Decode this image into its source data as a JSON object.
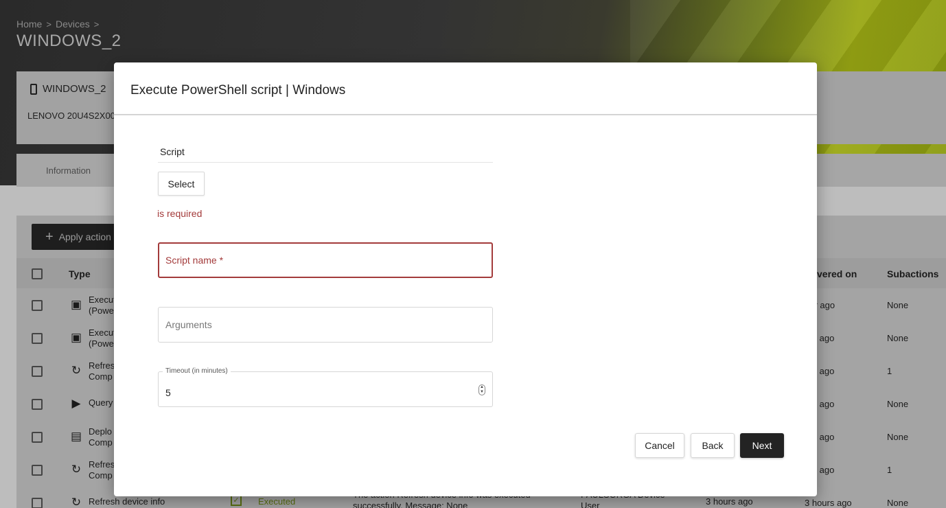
{
  "breadcrumb": {
    "home": "Home",
    "devices": "Devices",
    "separator": ">"
  },
  "page_title": "WINDOWS_2",
  "device_card": {
    "name": "WINDOWS_2",
    "model": "LENOVO 20U4S2X00"
  },
  "tabs": {
    "information": "Information"
  },
  "table": {
    "apply_action": "Apply action",
    "headers": {
      "type": "Type",
      "triggered_on": "vered on",
      "subactions": "Subactions"
    },
    "rows": [
      {
        "type": "Execut\n(Powe",
        "triggered": "our ago",
        "subactions": "None"
      },
      {
        "type": "Execut\n(Powe",
        "triggered": "urs ago",
        "subactions": "None"
      },
      {
        "type": "Refres\nComp",
        "triggered": "urs ago",
        "subactions": "1"
      },
      {
        "type": "Query",
        "triggered": "urs ago",
        "subactions": "None"
      },
      {
        "type": "Deplo\nComp",
        "triggered": "urs ago",
        "subactions": "None"
      },
      {
        "type": "Refres\nComp",
        "triggered": "urs ago",
        "subactions": "1"
      },
      {
        "type": "Refresh device info",
        "status": "Executed",
        "message": "The action Refresh device info was executed\nsuccessfully. Message: None",
        "user": "PAULSORGA Device\nUser",
        "delivered": "3 hours ago",
        "triggered": "3 hours ago",
        "subactions": "None"
      }
    ]
  },
  "modal": {
    "title": "Execute PowerShell script | Windows",
    "script_label": "Script",
    "select_button": "Select",
    "error_text": "is required",
    "script_name_placeholder": "Script name *",
    "arguments_placeholder": "Arguments",
    "timeout_label": "Timeout (in minutes)",
    "timeout_value": "5",
    "cancel": "Cancel",
    "back": "Back",
    "next": "Next"
  },
  "colors": {
    "error": "#a33a3a",
    "primary_button": "#232323",
    "accent": "#9aa814"
  }
}
